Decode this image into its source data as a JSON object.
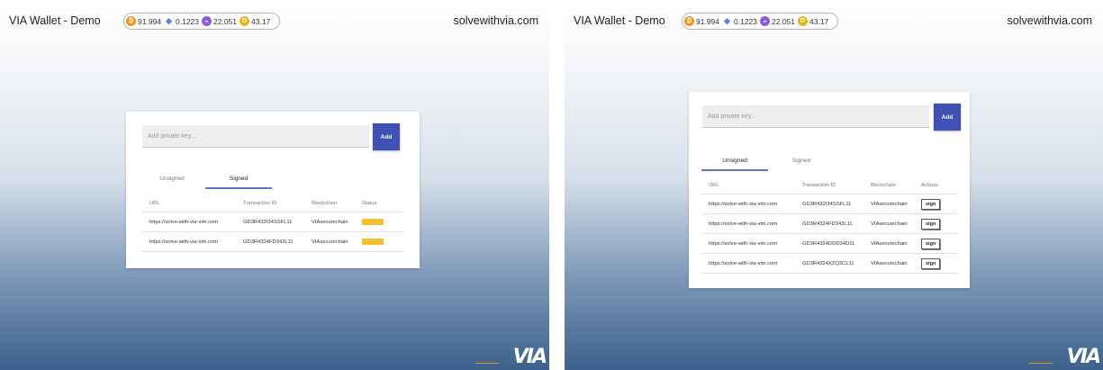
{
  "colors": {
    "accent": "#3f51b5",
    "pending": "#f5c030",
    "bitcoin": "#f7931a",
    "ethereum": "#627eea",
    "coin3": "#8a5fd8",
    "coin4": "#e8b416"
  },
  "screens": [
    {
      "app_title": "VIA Wallet - Demo",
      "site": "solvewithvia.com",
      "prices": [
        "91.994",
        "0.1223",
        "22.051",
        "43.17"
      ],
      "private_key_placeholder": "Add private key...",
      "add_label": "Add",
      "tabs": [
        "Unsigned",
        "Signed"
      ],
      "active_tab": "Signed",
      "columns": [
        "URL",
        "Transaction ID",
        "Blockchain",
        "Status"
      ],
      "rows": [
        {
          "url": "https://solve-with-via-vim.com",
          "tx": "GD3R432I34SSFL11",
          "chain": "VIAsecurechain",
          "status": "pending"
        },
        {
          "url": "https://solve-with-via-vim.com",
          "tx": "GD3R4324FD343L11",
          "chain": "VIAsecurechain",
          "status": "pending"
        }
      ],
      "logo": "VIA"
    },
    {
      "app_title": "VIA Wallet - Demo",
      "site": "solvewithvia.com",
      "prices": [
        "91.994",
        "0.1223",
        "22.051",
        "43.17"
      ],
      "private_key_placeholder": "Add private key...",
      "add_label": "Add",
      "tabs": [
        "Unsigned",
        "Signed"
      ],
      "active_tab": "Unsigned",
      "columns": [
        "URL",
        "Transaction ID",
        "Blockchain",
        "Actions"
      ],
      "rows": [
        {
          "url": "https://solve-with-via-vim.com",
          "tx": "GD3R432I34SSFL11",
          "chain": "VIAsecurechain",
          "action": "sign"
        },
        {
          "url": "https://solve-with-via-vim.com",
          "tx": "GD3R4324FD343L11",
          "chain": "VIAsecurechain",
          "action": "sign"
        },
        {
          "url": "https://solve-with-via-vim.com",
          "tx": "GD3R4324DDD34D11",
          "chain": "VIAsecurechain",
          "action": "sign"
        },
        {
          "url": "https://solve-with-via-vim.com",
          "tx": "GD3R4324XZQ3CL11",
          "chain": "VIAsecurechain",
          "action": "sign"
        }
      ],
      "logo": "VIA"
    }
  ]
}
